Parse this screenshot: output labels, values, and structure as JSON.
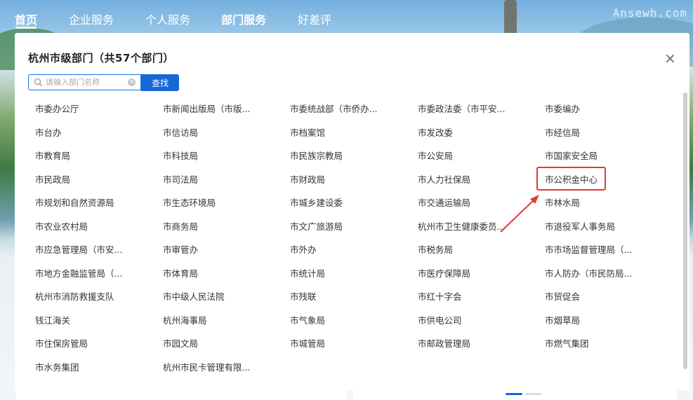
{
  "nav": {
    "items": [
      "首页",
      "企业服务",
      "个人服务",
      "部门服务",
      "好差评"
    ],
    "watermark": "Ansewh.com"
  },
  "modal": {
    "title": "杭州市级部门（共57个部门）",
    "close_icon": "close-icon",
    "search": {
      "placeholder": "请输入部门名称",
      "value": "",
      "button_label": "查找"
    },
    "columns": [
      [
        "市委办公厅",
        "市台办",
        "市教育局",
        "市民政局",
        "市规划和自然资源局",
        "市农业农村局",
        "市应急管理局（市安...",
        "市地方金融监管局（...",
        "杭州市消防救援支队",
        "钱江海关",
        "市住保房管局",
        "市水务集团"
      ],
      [
        "市新闻出版局（市版...",
        "市信访局",
        "市科技局",
        "市司法局",
        "市生态环境局",
        "市商务局",
        "市审管办",
        "市体育局",
        "市中级人民法院",
        "杭州海事局",
        "市园文局",
        "杭州市民卡管理有限..."
      ],
      [
        "市委统战部（市侨办...",
        "市档案馆",
        "市民族宗教局",
        "市财政局",
        "市城乡建设委",
        "市文广旅游局",
        "市外办",
        "市统计局",
        "市残联",
        "市气象局",
        "市城管局"
      ],
      [
        "市委政法委（市平安...",
        "市发改委",
        "市公安局",
        "市人力社保局",
        "市交通运输局",
        "杭州市卫生健康委员...",
        "市税务局",
        "市医疗保障局",
        "市红十字会",
        "市供电公司",
        "市邮政管理局"
      ],
      [
        "市委编办",
        "市经信局",
        "市国家安全局",
        "市公积金中心",
        "市林水局",
        "市退役军人事务局",
        "市市场监督管理局（...",
        "市人防办（市民防局...",
        "市贸促会",
        "市烟草局",
        "市燃气集团"
      ]
    ],
    "highlighted_item": "市公积金中心",
    "colors": {
      "accent": "#1667d7",
      "highlight": "#e03b2e"
    }
  }
}
